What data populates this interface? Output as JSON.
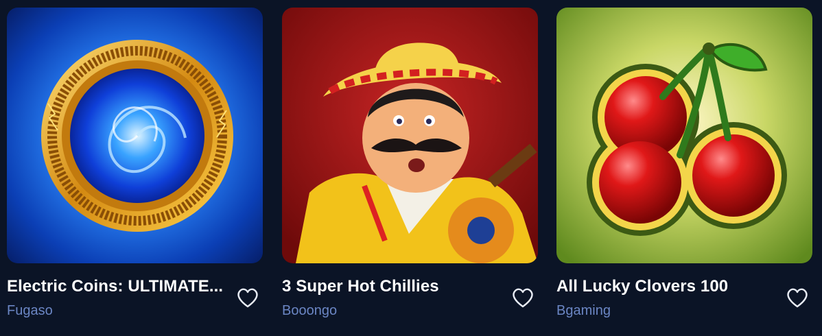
{
  "games": [
    {
      "title": "Electric Coins: ULTIMATE...",
      "provider": "Fugaso",
      "thumbnail_icon": "electric-coin-icon",
      "favorite_icon": "heart-outline-icon",
      "accent": "#1e6fff"
    },
    {
      "title": "3 Super Hot Chillies",
      "provider": "Booongo",
      "thumbnail_icon": "mariachi-guitar-icon",
      "favorite_icon": "heart-outline-icon",
      "accent": "#b51a1a"
    },
    {
      "title": "All Lucky Clovers 100",
      "provider": "Bgaming",
      "thumbnail_icon": "cherries-icon",
      "favorite_icon": "heart-outline-icon",
      "accent": "#8fbf3a"
    }
  ],
  "colors": {
    "background": "#0b1426",
    "title_text": "#ffffff",
    "provider_text": "#6b86c4",
    "heart_stroke": "#e8ecf5"
  }
}
